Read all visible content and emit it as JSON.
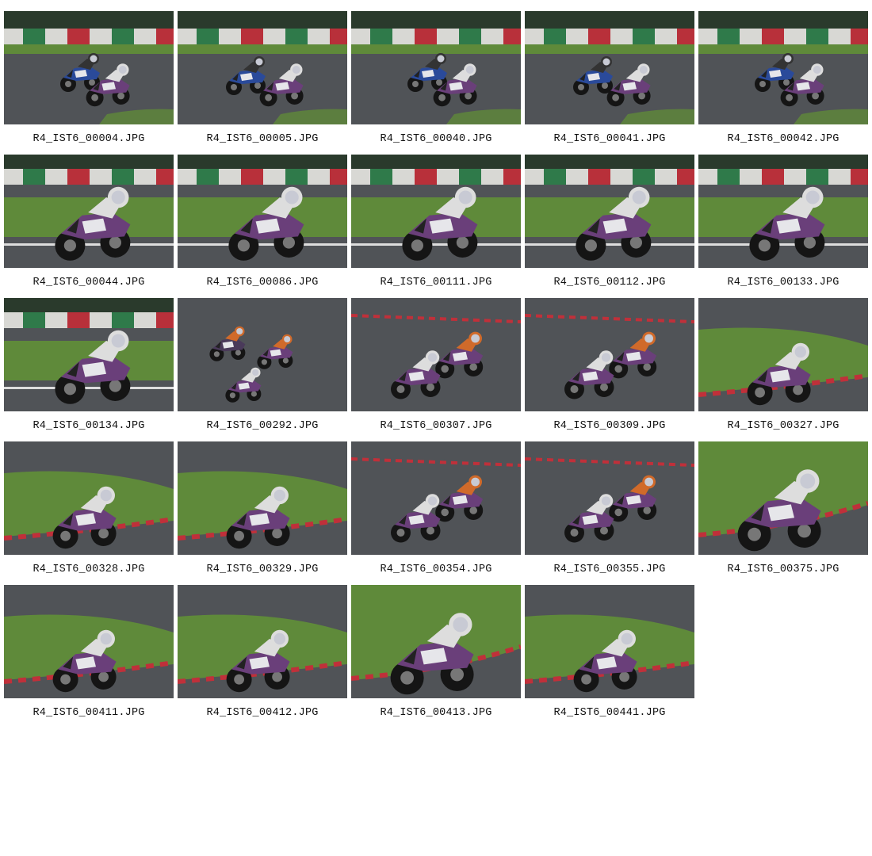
{
  "gallery": {
    "items": [
      {
        "filename": "R4_IST6_00004.JPG",
        "scene": "straight"
      },
      {
        "filename": "R4_IST6_00005.JPG",
        "scene": "straight"
      },
      {
        "filename": "R4_IST6_00040.JPG",
        "scene": "straight"
      },
      {
        "filename": "R4_IST6_00041.JPG",
        "scene": "straight"
      },
      {
        "filename": "R4_IST6_00042.JPG",
        "scene": "straight"
      },
      {
        "filename": "R4_IST6_00044.JPG",
        "scene": "straight-close"
      },
      {
        "filename": "R4_IST6_00086.JPG",
        "scene": "straight-close"
      },
      {
        "filename": "R4_IST6_00111.JPG",
        "scene": "straight-close"
      },
      {
        "filename": "R4_IST6_00112.JPG",
        "scene": "straight-close"
      },
      {
        "filename": "R4_IST6_00133.JPG",
        "scene": "straight-close"
      },
      {
        "filename": "R4_IST6_00134.JPG",
        "scene": "straight-close"
      },
      {
        "filename": "R4_IST6_00292.JPG",
        "scene": "asphalt-group"
      },
      {
        "filename": "R4_IST6_00307.JPG",
        "scene": "asphalt-pair"
      },
      {
        "filename": "R4_IST6_00309.JPG",
        "scene": "asphalt-pair"
      },
      {
        "filename": "R4_IST6_00327.JPG",
        "scene": "corner"
      },
      {
        "filename": "R4_IST6_00328.JPG",
        "scene": "corner"
      },
      {
        "filename": "R4_IST6_00329.JPG",
        "scene": "corner"
      },
      {
        "filename": "R4_IST6_00354.JPG",
        "scene": "asphalt-pair"
      },
      {
        "filename": "R4_IST6_00355.JPG",
        "scene": "asphalt-pair"
      },
      {
        "filename": "R4_IST6_00375.JPG",
        "scene": "corner-close"
      },
      {
        "filename": "R4_IST6_00411.JPG",
        "scene": "corner"
      },
      {
        "filename": "R4_IST6_00412.JPG",
        "scene": "corner"
      },
      {
        "filename": "R4_IST6_00413.JPG",
        "scene": "corner-close"
      },
      {
        "filename": "R4_IST6_00441.JPG",
        "scene": "corner"
      }
    ]
  },
  "colors": {
    "asphalt": "#505357",
    "grass": "#5f8a3a",
    "barrier_white": "#d8d8d4",
    "barrier_red": "#b8303a",
    "barrier_green": "#2f7a4a",
    "trees": "#2a3a2c",
    "bike_purple": "#6a3f7a",
    "bike_blue": "#2a4a9a",
    "rider_orange": "#d06a2a",
    "kerb_red": "#c0303a",
    "caption_text": "#111111"
  }
}
